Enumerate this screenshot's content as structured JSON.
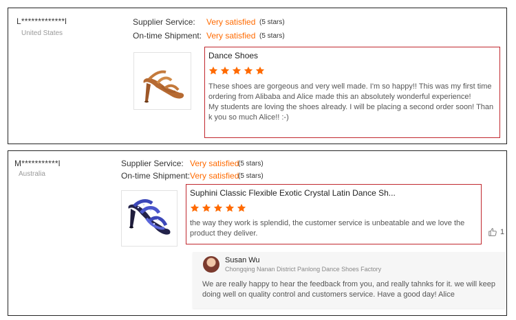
{
  "reviews": [
    {
      "reviewer": "L*************l",
      "country": "United States",
      "supplier_service_label": "Supplier Service:",
      "supplier_service_value": "Very satisfied",
      "supplier_service_stars": "(5 stars)",
      "shipment_label": "On-time Shipment:",
      "shipment_value": "Very satisfied",
      "shipment_stars": "(5 stars)",
      "product_title": "Dance Shoes",
      "rating": 5,
      "text": "These shoes are gorgeous and very well made. I'm so happy!! This was my first time ordering from Alibaba and Alice made this an absolutely wonderful experience!\nMy students are loving the shoes already. I will be placing a second order soon! Thank you so much Alice!! :-)",
      "product_image": "tan-satin-latin-dance-shoe"
    },
    {
      "reviewer": "M***********l",
      "country": "Australia",
      "supplier_service_label": "Supplier Service:",
      "supplier_service_value": "Very satisfied",
      "supplier_service_stars": "(5 stars)",
      "shipment_label": "On-time Shipment:",
      "shipment_value": "Very satisfied",
      "shipment_stars": "(5 stars)",
      "product_title": "Suphini Classic Flexible Exotic Crystal Latin Dance Sh...",
      "rating": 5,
      "text": "the way they work is splendid, the customer service is unbeatable and we love the product they deliver.",
      "product_image": "blue-crystal-latin-dance-shoe",
      "helpful_count": "1",
      "helpful_icon": "thumbs-up-icon",
      "reply": {
        "name": "Susan Wu",
        "company": "Chongqing Nanan District Panlong Dance Shoes Factory",
        "text": "We are really happy to hear the feedback from you, and really tahnks for it. we will keep doing well on quality control and customers service. Have a good day! Alice"
      }
    }
  ],
  "colors": {
    "accent": "#ff6a00",
    "highlight_border": "#c0262c",
    "card_border": "#222222",
    "muted_text": "#999999"
  }
}
